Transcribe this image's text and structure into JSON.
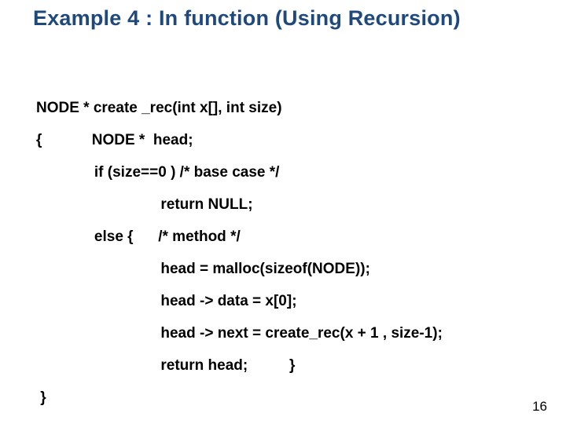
{
  "title": "Example 4 : In function (Using Recursion)",
  "code": {
    "l0": "NODE * create _rec(int x[], int size)",
    "l1": "{            NODE *  head;",
    "l2": "              if (size==0 ) /* base case */",
    "l3": "                              return NULL;",
    "l4": "              else {      /* method */",
    "l5": "                              head = malloc(sizeof(NODE));",
    "l6": "                              head -> data = x[0];",
    "l7": "                              head -> next = create_rec(x + 1 , size-1);",
    "l8": "                              return head;          }",
    "l9": " }"
  },
  "page_number": "16"
}
